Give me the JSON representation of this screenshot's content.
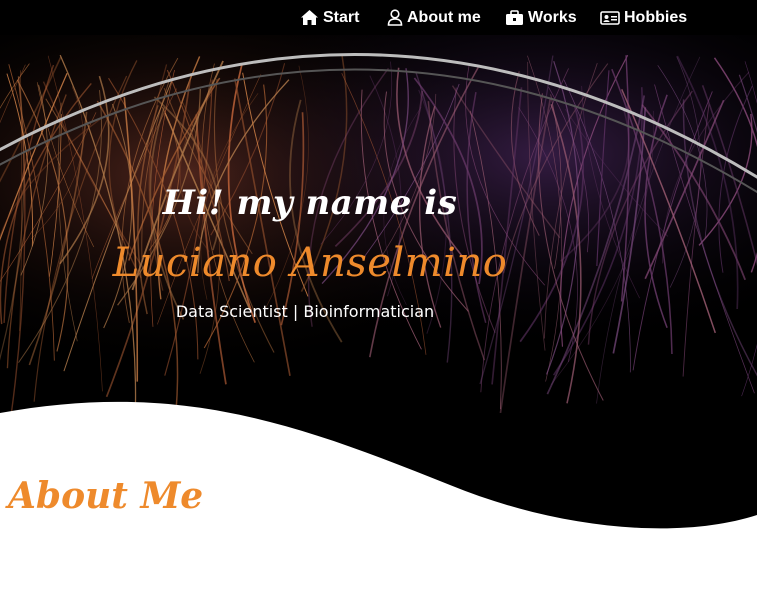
{
  "nav": {
    "items": [
      {
        "label": "Start",
        "icon": "home-icon"
      },
      {
        "label": "About me",
        "icon": "user-icon"
      },
      {
        "label": "Works",
        "icon": "briefcase-icon"
      },
      {
        "label": "Hobbies",
        "icon": "id-card-icon"
      }
    ]
  },
  "hero": {
    "greeting": "Hi! my name is",
    "name": "Luciano Anselmino",
    "subtitle": "Data Scientist | Bioinformatician"
  },
  "about": {
    "title": "About Me"
  },
  "colors": {
    "accent": "#ee8a2c",
    "background_dark": "#000000",
    "text_light": "#ffffff"
  }
}
